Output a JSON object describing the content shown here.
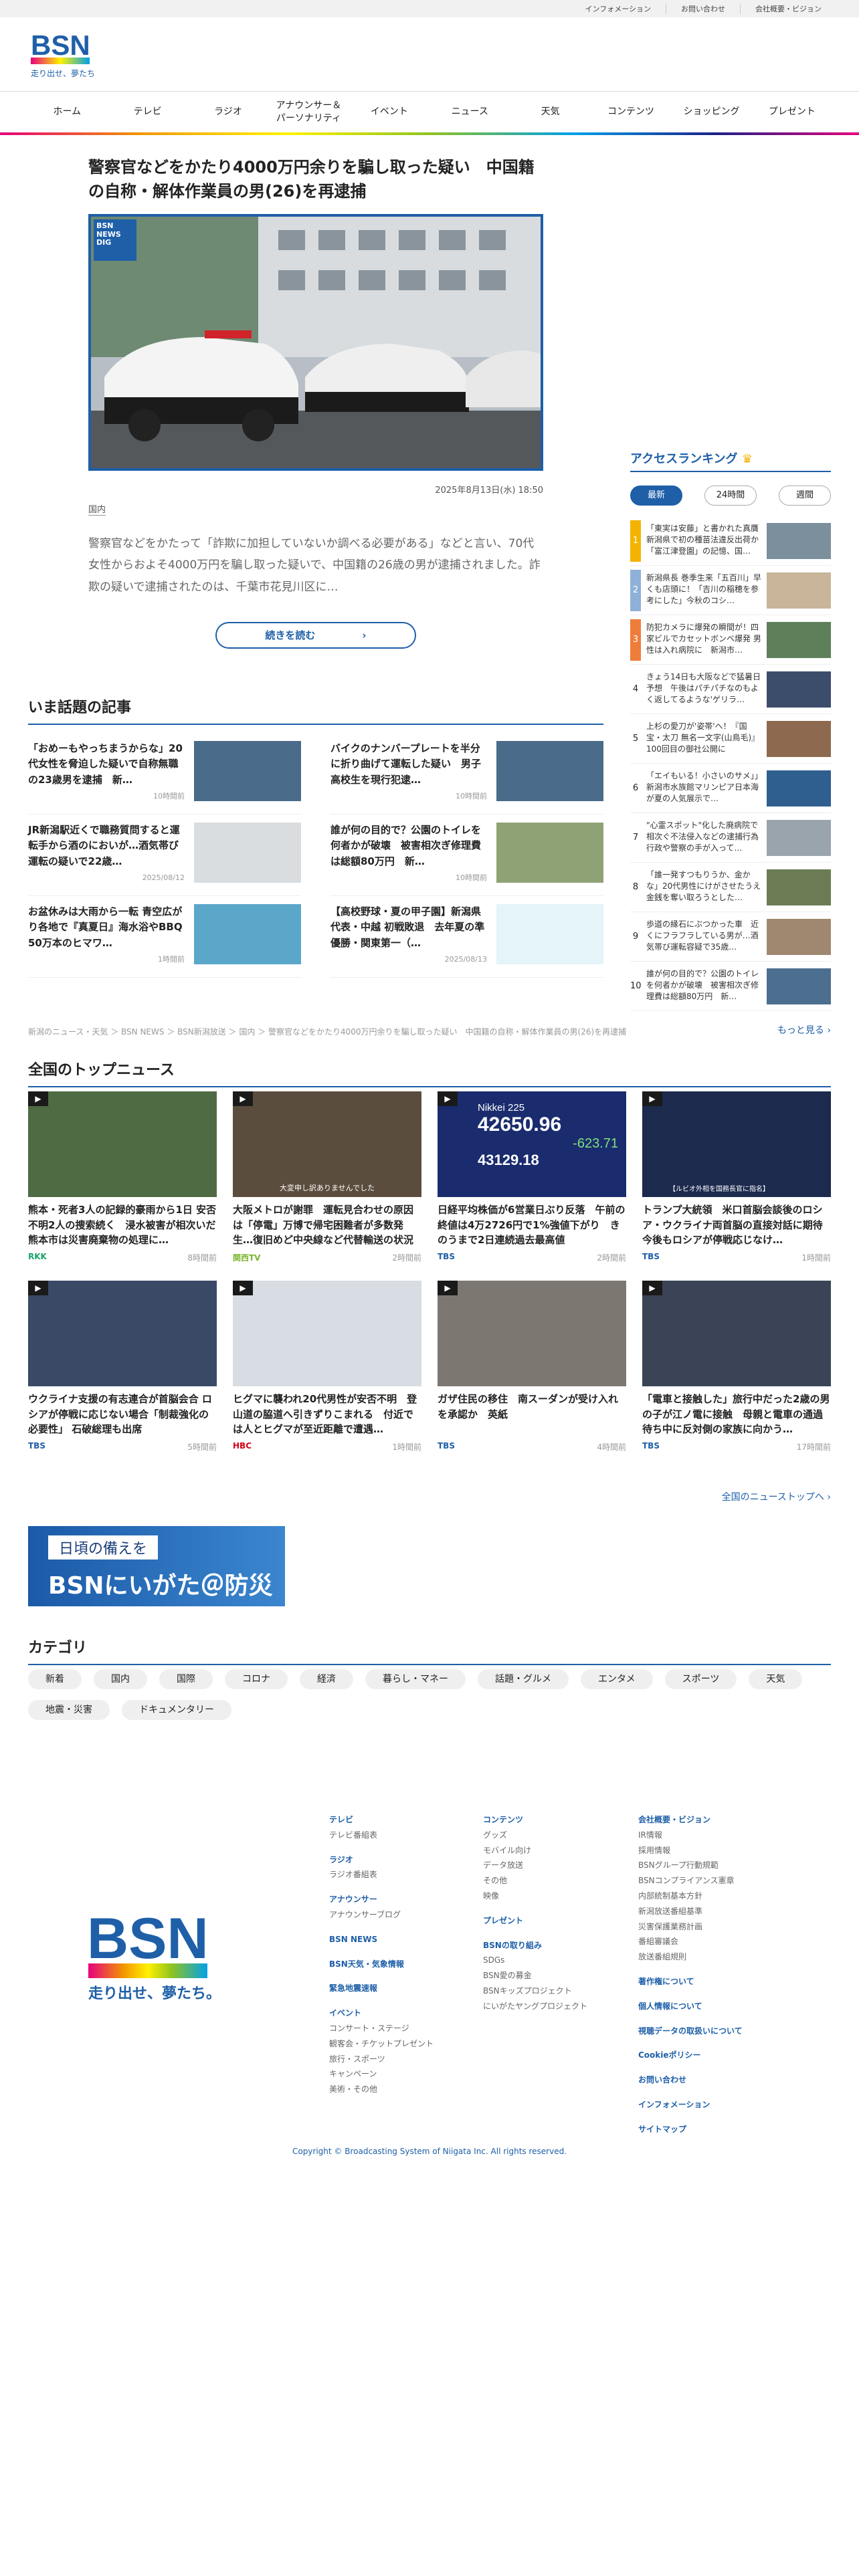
{
  "util_links": [
    "インフォメーション",
    "お問い合わせ",
    "会社概要・ビジョン"
  ],
  "logo": {
    "text": "BSN",
    "tagline": "走り出せ、夢たち。"
  },
  "nav": [
    "ホーム",
    "テレビ",
    "ラジオ",
    "アナウンサー＆\nパーソナリティ",
    "イベント",
    "ニュース",
    "天気",
    "コンテンツ",
    "ショッピング",
    "プレゼント"
  ],
  "lead": {
    "title": "警察官などをかたり4000万円余りを騙し取った疑い　中国籍の自称・解体作業員の男(26)を再逮捕",
    "badge": "BSN NEWS DIG",
    "date": "2025年8月13日(水) 18:50",
    "category": "国内",
    "summary": "警察官などをかたって「詐欺に加担していないか調べる必要がある」などと言い、70代女性からおよそ4000万円を騙し取った疑いで、中国籍の26歳の男が逮捕されました。詐欺の疑いで逮捕されたのは、千葉市花見川区に…",
    "read_more": "続きを読む"
  },
  "ranking": {
    "title": "アクセスランキング",
    "tabs": [
      "最新",
      "24時間",
      "週間"
    ],
    "items": [
      {
        "n": "1",
        "text": "「東実は安藤」と書かれた真贋 新潟県で初の種苗法違反出荷か「富江津登園」の記憶、国…"
      },
      {
        "n": "2",
        "text": "新潟県長 巻季生来「五百川」早くも店頭に！「吉川の稲穂を参考にした」今秋のコシ…"
      },
      {
        "n": "3",
        "text": "防犯カメラに爆発の瞬間が！四家ビルでカセットボンベ爆発 男性は入れ病院に　新潟市…"
      },
      {
        "n": "4",
        "text": "きょう14日も大阪などで猛暑日予想　午後はパチパチなのもよく返してるような'ゲリラ…"
      },
      {
        "n": "5",
        "text": "上杉の愛刀が'姿帯'へ！『国宝・太刀 無名一文字(山鳥毛)』100回目の御社公開に"
      },
      {
        "n": "6",
        "text": "「エイもいる！小さいのサメ」」新潟市水族館マリンピア日本海が夏の人気展示で…"
      },
      {
        "n": "7",
        "text": "\"心霊スポット\"化した廃病院で相次ぐ不法侵入などの逮捕行為　行政や警察の手が入って…"
      },
      {
        "n": "8",
        "text": "「誰一発すつもりうか、金かな」20代男性にけがさせたうえ金銭を奪い取ろうとした…"
      },
      {
        "n": "9",
        "text": "歩道の縁石にぶつかった車　近くにフラフラしている男が…酒気帯び運転容疑で35歳…"
      },
      {
        "n": "10",
        "text": "誰が何の目的で？公園のトイレを何者かが破壊　被害相次ぎ修理費は総額80万円　新…"
      }
    ],
    "more": "もっと見る"
  },
  "trending": {
    "title": "いま話題の記事",
    "items": [
      {
        "text": "「おめーもやっちまうからな」20代女性を脅迫した疑いで自称無職の23歳男を逮捕　新…",
        "time": "10時間前"
      },
      {
        "text": "バイクのナンバープレートを半分に折り曲げて運転した疑い　男子高校生を現行犯逮…",
        "time": "10時間前"
      },
      {
        "text": "JR新潟駅近くで職務質問すると運転手から酒のにおいが…酒気帯び運転の疑いで22歳…",
        "time": "2025/08/12"
      },
      {
        "text": "誰が何の目的で？公園のトイレを何者かが破壊　被害相次ぎ修理費は総額80万円　新…",
        "time": "10時間前"
      },
      {
        "text": "お盆休みは大雨から一転 青空広がり各地で『真夏日』海水浴やBBQ 50万本のヒマワ…",
        "time": "1時間前"
      },
      {
        "text": "【高校野球・夏の甲子園】新潟県代表・中越 初戦敗退　去年夏の準優勝・関東第一（…",
        "time": "2025/08/13"
      }
    ]
  },
  "breadcrumb": "新潟のニュース・天気 ＞ BSN NEWS ＞ BSN新潟放送 ＞ 国内 ＞ 警察官などをかたり4000万円余りを騙し取った疑い　中国籍の自称・解体作業員の男(26)を再逮捕",
  "national": {
    "title": "全国のトップニュース",
    "items": [
      {
        "text": "熊本・死者3人の記録的豪雨から1日 安否不明2人の捜索続く　浸水被害が相次いだ熊本市は災害廃棄物の処理に…",
        "src": "RKK",
        "src_color": "#1aa36b",
        "time": "8時間前"
      },
      {
        "text": "大阪メトロが謝罪　運転見合わせの原因は「停電」万博で帰宅困難者が多数発生…復旧めど中央線など代替輸送の状況な…",
        "src": "関西TV",
        "src_color": "#7cb52f",
        "time": "2時間前"
      },
      {
        "text": "日経平均株価が6営業日ぶり反落　午前の終値は4万2726円で1%強値下がり　きのうまで2日連続過去最高値",
        "src": "TBS",
        "src_color": "#1e5fa8",
        "time": "2時間前"
      },
      {
        "text": "トランプ大統領　米口首脳会談後のロシア・ウクライナ両首脳の直接対話に期待　今後もロシアが停戦応じなけ…",
        "src": "TBS",
        "src_color": "#1e5fa8",
        "time": "1時間前"
      },
      {
        "text": "ウクライナ支援の有志連合が首脳会合 ロシアが停戦に応じない場合「制裁強化の必要性」 石破総理も出席",
        "src": "TBS",
        "src_color": "#1e5fa8",
        "time": "5時間前"
      },
      {
        "text": "ヒグマに襲われ20代男性が安否不明　登山道の脇道へ引きずりこまれる　付近では人とヒグマが至近距離で遭遇…",
        "src": "HBC",
        "src_color": "#d4001a",
        "time": "1時間前"
      },
      {
        "text": "ガザ住民の移住　南スーダンが受け入れを承認か　英紙",
        "src": "TBS",
        "src_color": "#1e5fa8",
        "time": "4時間前"
      },
      {
        "text": "「電車と接触した」旅行中だった2歳の男の子が江ノ電に接触　母親と電車の通過待ち中に反対側の家族に向かう…",
        "src": "TBS",
        "src_color": "#1e5fa8",
        "time": "17時間前"
      }
    ],
    "more": "全国のニューストップへ",
    "stock_label": "Nikkei 225",
    "stock_values": [
      "42650.96",
      "-623.71",
      "43129.18"
    ],
    "caption_2": "大変申し訳ありませんでした",
    "caption_4": "【ルビオ外相を国務長官に指名】"
  },
  "banner": {
    "line1": "日頃の備えを",
    "line2": "BSNにいがた＠防災"
  },
  "categories": {
    "title": "カテゴリ",
    "items": [
      "新着",
      "国内",
      "国際",
      "コロナ",
      "経済",
      "暮らし・マネー",
      "話題・グルメ",
      "エンタメ",
      "スポーツ",
      "天気",
      "地震・災害",
      "ドキュメンタリー"
    ]
  },
  "footer": {
    "col1": [
      {
        "h": "テレビ",
        "l": [
          "テレビ番組表"
        ]
      },
      {
        "h": "ラジオ",
        "l": [
          "ラジオ番組表"
        ]
      },
      {
        "h": "アナウンサー",
        "l": [
          "アナウンサーブログ"
        ]
      },
      {
        "h": "BSN NEWS",
        "l": []
      },
      {
        "h": "BSN天気・気象情報",
        "l": []
      },
      {
        "h": "緊急地震速報",
        "l": []
      },
      {
        "h": "イベント",
        "l": [
          "コンサート・ステージ",
          "観客会・チケットプレゼント",
          "旅行・スポーツ",
          "キャンペーン",
          "美術・その他"
        ]
      }
    ],
    "col2": [
      {
        "h": "コンテンツ",
        "l": [
          "グッズ",
          "モバイル向け",
          "データ放送",
          "その他",
          "映像"
        ]
      },
      {
        "h": "プレゼント",
        "l": []
      },
      {
        "h": "BSNの取り組み",
        "l": [
          "SDGs",
          "BSN愛の募金",
          "BSNキッズプロジェクト",
          "にいがたヤングプロジェクト"
        ]
      }
    ],
    "col3": [
      {
        "h": "会社概要・ビジョン",
        "l": [
          "IR情報",
          "採用情報",
          "BSNグループ行動規範",
          "BSNコンプライアンス憲章",
          "内部統制基本方針",
          "新潟放送番組基準",
          "災害保護業務計画",
          "番組審議会",
          "放送番組規則"
        ]
      },
      {
        "h": "著作権について",
        "l": []
      },
      {
        "h": "個人情報について",
        "l": []
      },
      {
        "h": "視聴データの取扱いについて",
        "l": []
      },
      {
        "h": "Cookieポリシー",
        "l": []
      },
      {
        "h": "お問い合わせ",
        "l": []
      },
      {
        "h": "インフォメーション",
        "l": []
      },
      {
        "h": "サイトマップ",
        "l": []
      }
    ],
    "copyright": "Copyright © Broadcasting System of Niigata Inc. All rights reserved."
  },
  "colors": {
    "accent": "#1e5fa8",
    "rank_top": "#f39800"
  }
}
